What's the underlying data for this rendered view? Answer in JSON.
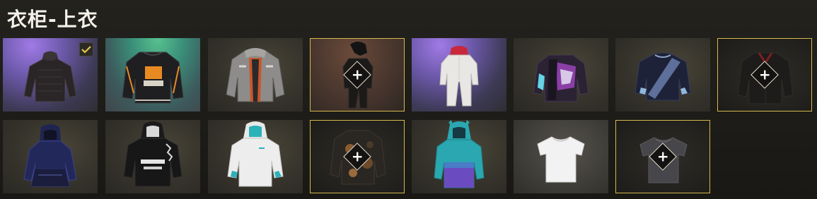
{
  "page": {
    "title": "衣柜-上衣"
  },
  "plus_glyph": "+",
  "colors": {
    "accent_outline": "#d6b84e",
    "equipped_check": "#e8c84a"
  },
  "tiles": [
    {
      "id": "t1",
      "item": "black-turtleneck-sweater",
      "equipped": true,
      "locked": false
    },
    {
      "id": "t2",
      "item": "black-orange-bomber-jacket",
      "equipped": false,
      "locked": false
    },
    {
      "id": "t3",
      "item": "gray-orange-jacket",
      "equipped": false,
      "locked": false
    },
    {
      "id": "t4",
      "item": "black-hooded-outfit",
      "equipped": false,
      "locked": true
    },
    {
      "id": "t5",
      "item": "white-jumpsuit-red-scarf",
      "equipped": false,
      "locked": false
    },
    {
      "id": "t6",
      "item": "purple-print-jacket",
      "equipped": false,
      "locked": false
    },
    {
      "id": "t7",
      "item": "navy-sweater-sash",
      "equipped": false,
      "locked": false
    },
    {
      "id": "t8",
      "item": "dark-red-collar-jacket",
      "equipped": false,
      "locked": true
    },
    {
      "id": "t9",
      "item": "navy-hooded-dress",
      "equipped": false,
      "locked": false
    },
    {
      "id": "t10",
      "item": "black-hoodie",
      "equipped": false,
      "locked": false
    },
    {
      "id": "t11",
      "item": "white-hoodie-teal",
      "equipped": false,
      "locked": false
    },
    {
      "id": "t12",
      "item": "camo-jacket",
      "equipped": false,
      "locked": true
    },
    {
      "id": "t13",
      "item": "teal-purple-hoodie",
      "equipped": false,
      "locked": false
    },
    {
      "id": "t14",
      "item": "white-tshirt",
      "equipped": false,
      "locked": false
    },
    {
      "id": "t15",
      "item": "gray-tshirt",
      "equipped": false,
      "locked": true
    }
  ]
}
